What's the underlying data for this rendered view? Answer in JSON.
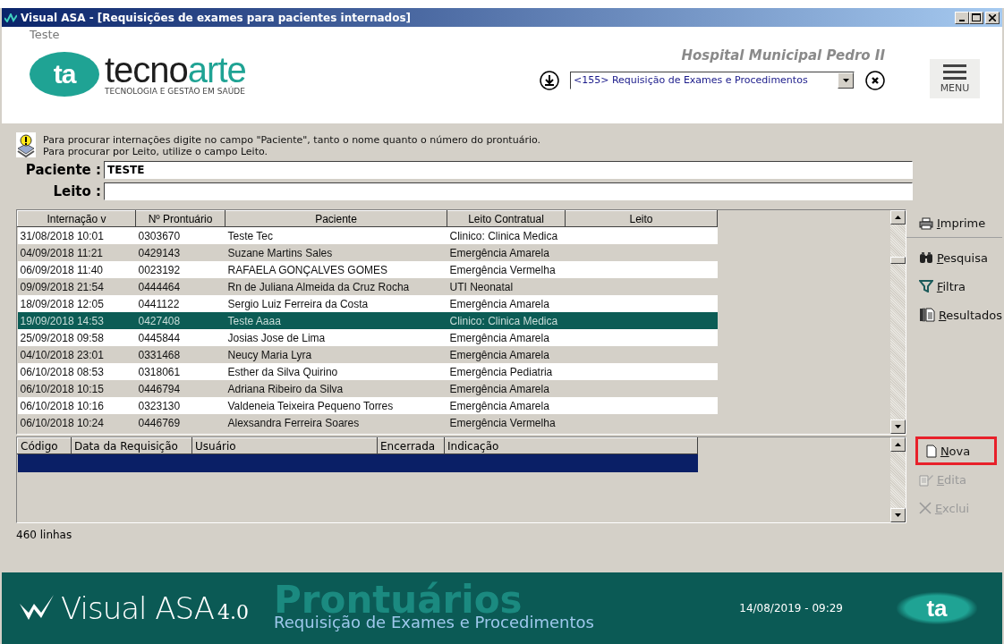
{
  "window": {
    "title": "Visual ASA - [Requisições de exames para pacientes internados]"
  },
  "header": {
    "user": "Teste",
    "logo": {
      "mark": "ta",
      "word": "tecno",
      "word_accent": "arte",
      "tagline": "TECNOLOGIA E GESTÃO EM SAÚDE"
    },
    "hospital": "Hospital Municipal Pedro II",
    "module_select": {
      "value": "<155> Requisição de Exames e Procedimentos"
    },
    "menu_label": "MENU"
  },
  "hint": {
    "lines": [
      "Para procurar internações digite no campo \"Paciente\", tanto o nome quanto o número do prontuário.",
      "Para procurar por Leito, utilize o campo Leito."
    ]
  },
  "search": {
    "paciente": {
      "label": "Paciente :",
      "value": "TESTE"
    },
    "leito": {
      "label": "Leito :"
    }
  },
  "table": {
    "columns": [
      "Internação v",
      "Nº Prontuário",
      "Paciente",
      "Leito Contratual",
      "Leito"
    ],
    "rows": [
      {
        "cells": [
          "31/08/2018 10:01",
          "0303670",
          "Teste Tec",
          "Clinico: Clinica Medica"
        ],
        "selected": false
      },
      {
        "cells": [
          "04/09/2018 11:21",
          "0429143",
          "Suzane Martins Sales",
          "Emergência Amarela"
        ],
        "selected": false
      },
      {
        "cells": [
          "06/09/2018 11:40",
          "0023192",
          "RAFAELA GONÇALVES GOMES",
          "Emergência Vermelha"
        ],
        "selected": false
      },
      {
        "cells": [
          "09/09/2018 21:54",
          "0444464",
          "Rn de Juliana Almeida da Cruz Rocha",
          "UTI Neonatal"
        ],
        "selected": false
      },
      {
        "cells": [
          "18/09/2018 12:05",
          "0441122",
          "Sergio Luiz Ferreira da Costa",
          "Emergência Amarela"
        ],
        "selected": false
      },
      {
        "cells": [
          "19/09/2018 14:53",
          "0427408",
          "Teste Aaaa",
          "Clinico: Clinica Medica"
        ],
        "selected": true
      },
      {
        "cells": [
          "25/09/2018 09:58",
          "0445844",
          "Josias Jose de Lima",
          "Emergência Amarela"
        ],
        "selected": false
      },
      {
        "cells": [
          "04/10/2018 23:01",
          "0331468",
          "Neucy Maria Lyra",
          "Emergência Amarela"
        ],
        "selected": false
      },
      {
        "cells": [
          "06/10/2018 08:53",
          "0318061",
          "Esther da Silva Quirino",
          "Emergência Pediatria"
        ],
        "selected": false
      },
      {
        "cells": [
          "06/10/2018 10:15",
          "0446794",
          "Adriana Ribeiro da Silva",
          "Emergência Amarela"
        ],
        "selected": false
      },
      {
        "cells": [
          "06/10/2018 10:16",
          "0323130",
          "Valdeneia Teixeira Pequeno Torres",
          "Emergência Amarela"
        ],
        "selected": false
      },
      {
        "cells": [
          "06/10/2018 10:24",
          "0446769",
          "Alexsandra Ferreira Soares",
          "Emergência Vermelha"
        ],
        "selected": false
      }
    ]
  },
  "requests": {
    "columns": [
      "Código",
      "Data da Requisição",
      "Usuário",
      "Encerrada",
      "Indicação"
    ],
    "rows": [
      {
        "selected": true
      }
    ]
  },
  "actions_top": [
    {
      "label": "Imprime",
      "kind": "print"
    },
    {
      "label": "Pesquisa",
      "kind": "search"
    },
    {
      "label": "Filtra",
      "kind": "filter"
    },
    {
      "label": "Resultados",
      "kind": "results"
    }
  ],
  "actions_bottom": [
    {
      "label": "Nova",
      "kind": "new",
      "highlighted": true,
      "disabled": false
    },
    {
      "label": "Edita",
      "kind": "edit",
      "highlighted": false,
      "disabled": true
    },
    {
      "label": "Exclui",
      "kind": "delete",
      "highlighted": false,
      "disabled": true
    }
  ],
  "status": "460 linhas",
  "footer": {
    "brand": "Visual ASA",
    "version": "4.0",
    "module": "Prontuários",
    "subtitle": "Requisição de Exames e Procedimentos",
    "datetime": "14/08/2019 - 09:29",
    "mark": "ta"
  }
}
